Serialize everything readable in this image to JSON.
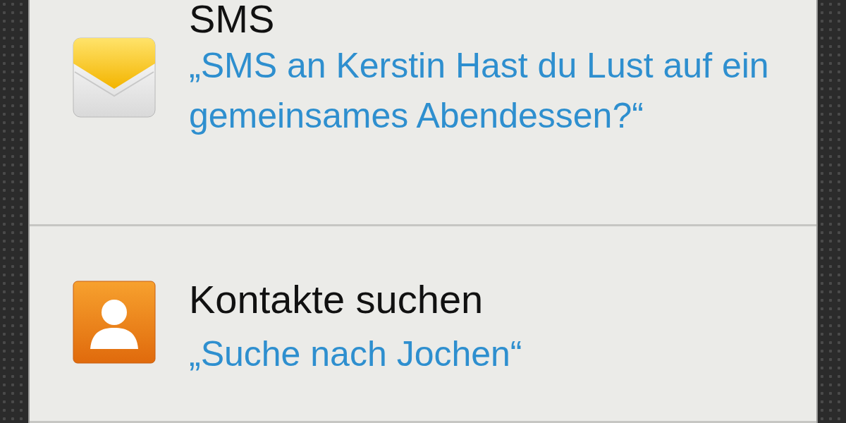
{
  "commands": [
    {
      "kind": "sms",
      "title": "SMS",
      "example": "„SMS an Kerstin Hast du Lust auf ein gemeinsames Abendessen?“"
    },
    {
      "kind": "contacts",
      "title": "Kontakte suchen",
      "example": "„Suche nach Jochen“"
    }
  ]
}
